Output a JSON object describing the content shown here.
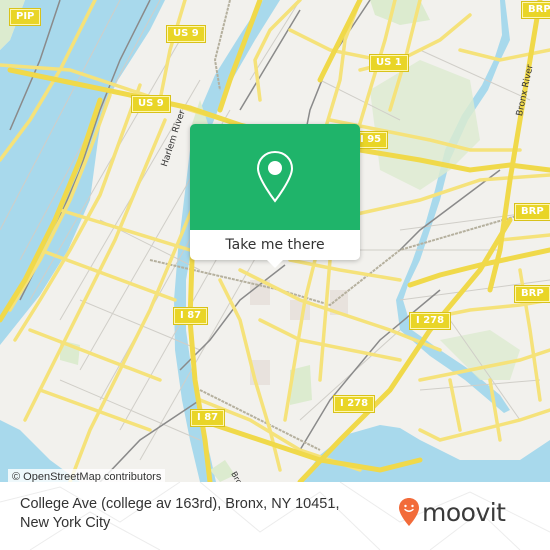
{
  "map": {
    "shields": [
      {
        "label": "PIP"
      },
      {
        "label": "US 9"
      },
      {
        "label": "US 9"
      },
      {
        "label": "US 1"
      },
      {
        "label": "I 95"
      },
      {
        "label": "BRP"
      },
      {
        "label": "BRP"
      },
      {
        "label": "BRP"
      },
      {
        "label": "I 87"
      },
      {
        "label": "I 87"
      },
      {
        "label": "I 278"
      },
      {
        "label": "I 278"
      }
    ],
    "river_labels": {
      "harlem": "Harlem River",
      "bronx": "Bronx River",
      "bruckner": "Bro"
    },
    "attribution": "© OpenStreetMap contributors"
  },
  "popup": {
    "icon": "location-pin-icon",
    "button_label": "Take me there",
    "accent_color": "#1fb46a"
  },
  "footer": {
    "address_line1": "College Ave (college av 163rd), Bronx, NY 10451,",
    "address_line2": "New York City",
    "logo_text": "moovit",
    "logo_color": "#f26b3a"
  }
}
